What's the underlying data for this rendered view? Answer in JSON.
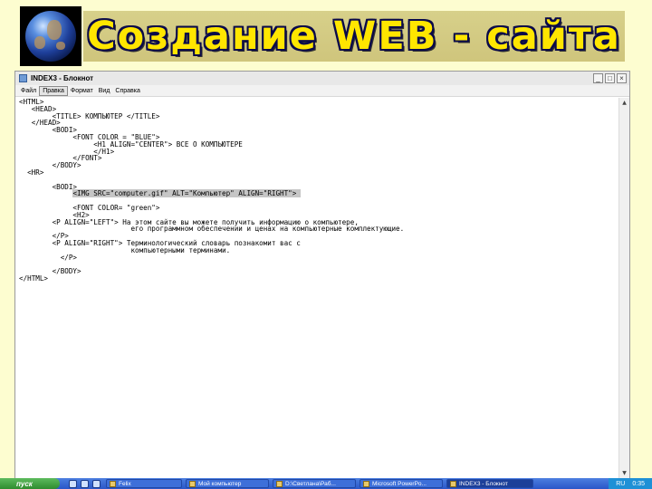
{
  "banner": {
    "title": "Создание WEB - сайта"
  },
  "window": {
    "title": "INDEX3 - Блокнот",
    "buttons": {
      "minimize": "_",
      "maximize": "□",
      "close": "×"
    },
    "menu": [
      "Файл",
      "Правка",
      "Формат",
      "Вид",
      "Справка"
    ],
    "code_lines": [
      "<HTML>",
      "   <HEAD>",
      "        <TITLE> КОМПЬЮТЕР </TITLE>",
      "   </HEAD>",
      "        <BODI>",
      "             <FONT COLOR = \"BLUE\">",
      "                  <H1 ALIGN=\"CENTER\"> ВСЕ О КОМПЬЮТЕРЕ",
      "                  </H1>",
      "             </FONT>",
      "        </BODY>",
      "  <HR>",
      "",
      "        <BODI>",
      "             <IMG SRC=\"computer.gif\" ALT=\"Компьютер\" ALIGN=\"RIGHT\">",
      "",
      "             <FONT COLOR= \"green\">",
      "             <H2>",
      "        <P ALIGN=\"LEFT\"> На этом сайте вы можете получить информацию о компьютере,",
      "                           его программном обеспечении и ценах на компьютерные комплектующие.",
      "        </P>",
      "        <P ALIGN=\"RIGHT\"> Терминологический словарь познакомит вас с",
      "                           компьютерными терминами.",
      "          </P>",
      "",
      "        </BODY>",
      "</HTML>"
    ],
    "highlighted_line": 13
  },
  "taskbar": {
    "start": "пуск",
    "tasks": [
      "Felix",
      "Мой компьютер",
      "D:\\Светлана\\Раб...",
      "Microsoft PowerPo...",
      "INDEX3 - Блокнот"
    ],
    "language": "RU",
    "clock": "0:35"
  }
}
